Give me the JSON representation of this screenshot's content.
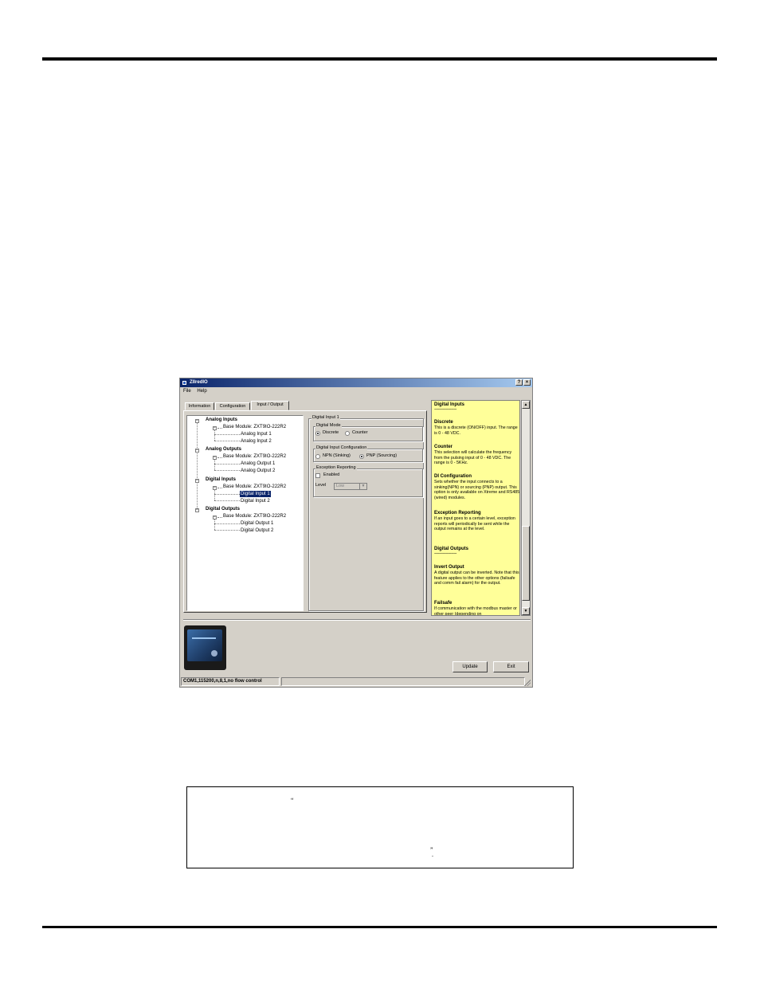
{
  "window": {
    "title": "ZIIredIO",
    "buttons": {
      "help": "?",
      "close": "×"
    },
    "menu": [
      "File",
      "Help"
    ],
    "tabs": [
      "Information",
      "Configuration",
      "Input / Output"
    ],
    "active_tab": "Input / Output"
  },
  "tree": {
    "analog_inputs": "Analog Inputs",
    "ai_base": "Base Module: ZXT9IO-222R2",
    "ai_1": "Analog Input 1",
    "ai_2": "Analog Input 2",
    "analog_outputs": "Analog Outputs",
    "ao_base": "Base Module: ZXT9IO-222R2",
    "ao_1": "Analog Output 1",
    "ao_2": "Analog Output 2",
    "digital_inputs": "Digital Inputs",
    "di_base": "Base Module: ZXT9IO-222R2",
    "di_1": "Digital Input 1",
    "di_2": "Digital Input 2",
    "digital_outputs": "Digital Outputs",
    "do_base": "Base Module: ZXT9IO-222R2",
    "do_1": "Digital Output 1",
    "do_2": "Digital Output 2"
  },
  "config": {
    "group_title": "Digital Input 1",
    "mode_title": "Digital Mode",
    "mode_discrete": "Discrete",
    "mode_counter": "Counter",
    "input_config_title": "Digital Input Configuration",
    "npn": "NPN (Sinking)",
    "pnp": "PNP (Sourcing)",
    "exception_title": "Exception Reporting",
    "enabled": "Enabled",
    "level_label": "Level",
    "level_value": "Low"
  },
  "help": {
    "s1_head": "Digital Inputs",
    "s1_dash": "------------------------",
    "s2_head": "Discrete",
    "s2_body": "This is a discrete (ON/OFF) input. The range is 0 - 48 VDC.",
    "s3_head": "Counter",
    "s3_body": "This selection will calculate the frequency from the pulsing input of 0 - 48 VDC. The range is 0 - 5KHz.",
    "s4_head": "DI Configuration",
    "s4_body": "Sets whether the input connects to a sinking(NPN) or sourcing (PNP) output. This option is only available on Xtreme and RS485 (wired) modules.",
    "s5_head": "Exception Reporting",
    "s5_body": "If an input goes to a certain level, exception reports will periodically be sent while the output remains at the level.",
    "s6_head": "Digital Outputs",
    "s6_dash": "------------------------",
    "s7_head": "Invert Output",
    "s7_body": "A digital output can be inverted. Note that this feature applies to the other options (failsafe and comm fail alarm) for the output.",
    "s8_head": "Failsafe",
    "s8_body": "If communication with the modbus master or other peer (depending on"
  },
  "buttons": {
    "update": "Update",
    "exit": "Exit"
  },
  "status": {
    "connection": "COM1,115200,n,8,1,no flow control",
    "secondary": ""
  },
  "note": {
    "mark1": "“",
    "mark2": "”",
    "mark3": "."
  }
}
